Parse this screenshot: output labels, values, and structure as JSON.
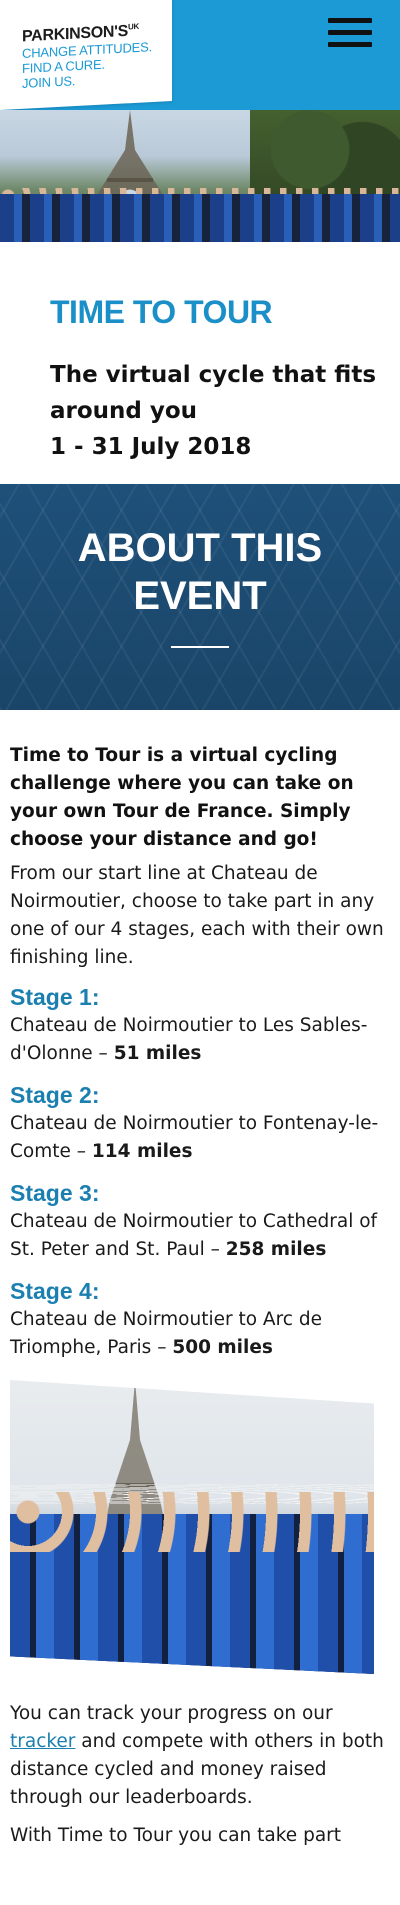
{
  "header": {
    "brand": "PARKINSON'S",
    "brand_sup": "UK",
    "tagline_lines": [
      "CHANGE ATTITUDES.",
      "FIND A CURE.",
      "JOIN US."
    ]
  },
  "intro": {
    "title": "TIME TO TOUR",
    "subtitle_line1": "The virtual cycle that fits",
    "subtitle_line2": "around you",
    "dates": "1 - 31 July 2018"
  },
  "about": {
    "title_line1": "ABOUT THIS",
    "title_line2": "EVENT"
  },
  "content": {
    "lead": "Time to Tour is a virtual cycling challenge where you can take on your own Tour de France. Simply choose your distance and go!",
    "para1": "From our start line at Chateau de Noirmoutier, choose to take part in any one of our 4 stages, each with their own finishing line.",
    "stages": [
      {
        "title": "Stage 1:",
        "route": "Chateau de Noirmoutier to Les Sables-d'Olonne – ",
        "distance": "51 miles"
      },
      {
        "title": "Stage 2:",
        "route": "Chateau de Noirmoutier to Fontenay-le-Comte – ",
        "distance": "114 miles"
      },
      {
        "title": "Stage 3:",
        "route": "Chateau de Noirmoutier to Cathedral of St. Peter and St. Paul – ",
        "distance": "258 miles"
      },
      {
        "title": "Stage 4:",
        "route": "Chateau de Noirmoutier to Arc de Triomphe, Paris – ",
        "distance": "500 miles"
      }
    ],
    "track_before": "You can track your progress on our ",
    "track_link": "tracker",
    "track_after": " and compete with others in both distance cycled and money raised through our leaderboards.",
    "para_last": "With Time to Tour you can take part"
  },
  "colors": {
    "brand_blue": "#1b9ad6",
    "stage_blue": "#1b7fb0",
    "banner_navy": "#1d4d72"
  },
  "icons": {
    "menu": "hamburger-icon"
  }
}
